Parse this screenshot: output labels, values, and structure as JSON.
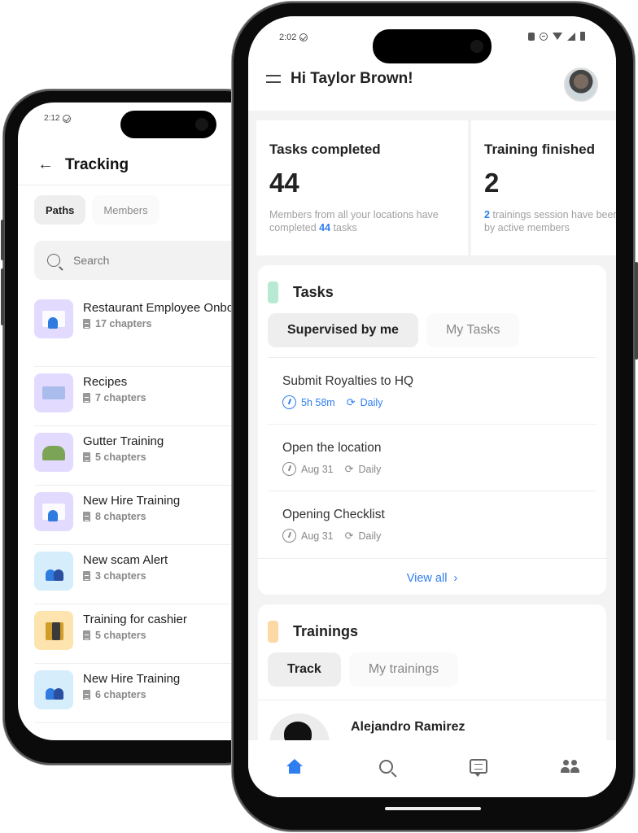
{
  "tracking_screen": {
    "status_time": "2:12",
    "title": "Tracking",
    "tabs": [
      {
        "label": "Paths",
        "active": true
      },
      {
        "label": "Members",
        "active": false
      }
    ],
    "search": {
      "placeholder": "Search",
      "value": ""
    },
    "paths": [
      {
        "name": "Restaurant Employee Onboarding",
        "chapters": "17 chapters",
        "thumb_color": "#e3dbff",
        "thumb_style": "office"
      },
      {
        "name": "Recipes",
        "chapters": "7 chapters",
        "thumb_color": "#e3dbff",
        "thumb_style": "books"
      },
      {
        "name": "Gutter Training",
        "chapters": "5 chapters",
        "thumb_color": "#e3dbff",
        "thumb_style": "sandwich"
      },
      {
        "name": "New Hire Training",
        "chapters": "8 chapters",
        "thumb_color": "#e3dbff",
        "thumb_style": "office"
      },
      {
        "name": "New scam Alert",
        "chapters": "3 chapters",
        "thumb_color": "#d6eefc",
        "thumb_style": "people"
      },
      {
        "name": "Training for cashier",
        "chapters": "5 chapters",
        "thumb_color": "#fde3ad",
        "thumb_style": "city"
      },
      {
        "name": "New Hire Training",
        "chapters": "6 chapters",
        "thumb_color": "#d6eefc",
        "thumb_style": "people"
      }
    ]
  },
  "dashboard_screen": {
    "status_time": "2:02",
    "greeting": "Hi Taylor Brown!",
    "stats": [
      {
        "title": "Tasks completed",
        "value": "44",
        "desc_prefix": "Members from all your locations have completed ",
        "desc_highlight": "44",
        "desc_suffix": " tasks"
      },
      {
        "title": "Training finished",
        "value": "2",
        "desc_prefix": "",
        "desc_highlight": "2",
        "desc_suffix": " trainings session have been completed by active members"
      }
    ],
    "tasks_card": {
      "title": "Tasks",
      "accent_color": "#b8ead3",
      "tabs": [
        {
          "label": "Supervised by me",
          "active": true
        },
        {
          "label": "My Tasks",
          "active": false
        }
      ],
      "items": [
        {
          "name": "Submit Royalties to HQ",
          "due": "5h 58m",
          "repeat": "Daily",
          "urgent": true
        },
        {
          "name": "Open the location",
          "due": "Aug 31",
          "repeat": "Daily",
          "urgent": false
        },
        {
          "name": "Opening Checklist",
          "due": "Aug 31",
          "repeat": "Daily",
          "urgent": false
        }
      ],
      "view_all": "View all"
    },
    "trainings_card": {
      "title": "Trainings",
      "accent_color": "#fcd9a4",
      "tabs": [
        {
          "label": "Track",
          "active": true
        },
        {
          "label": "My trainings",
          "active": false
        }
      ],
      "trainees": [
        {
          "name": "Alejandro Ramirez"
        }
      ]
    },
    "bottom_nav": [
      {
        "name": "home",
        "active": true
      },
      {
        "name": "search",
        "active": false
      },
      {
        "name": "messages",
        "active": false
      },
      {
        "name": "team",
        "active": false
      }
    ],
    "accent_color": "#2f7ef0"
  }
}
